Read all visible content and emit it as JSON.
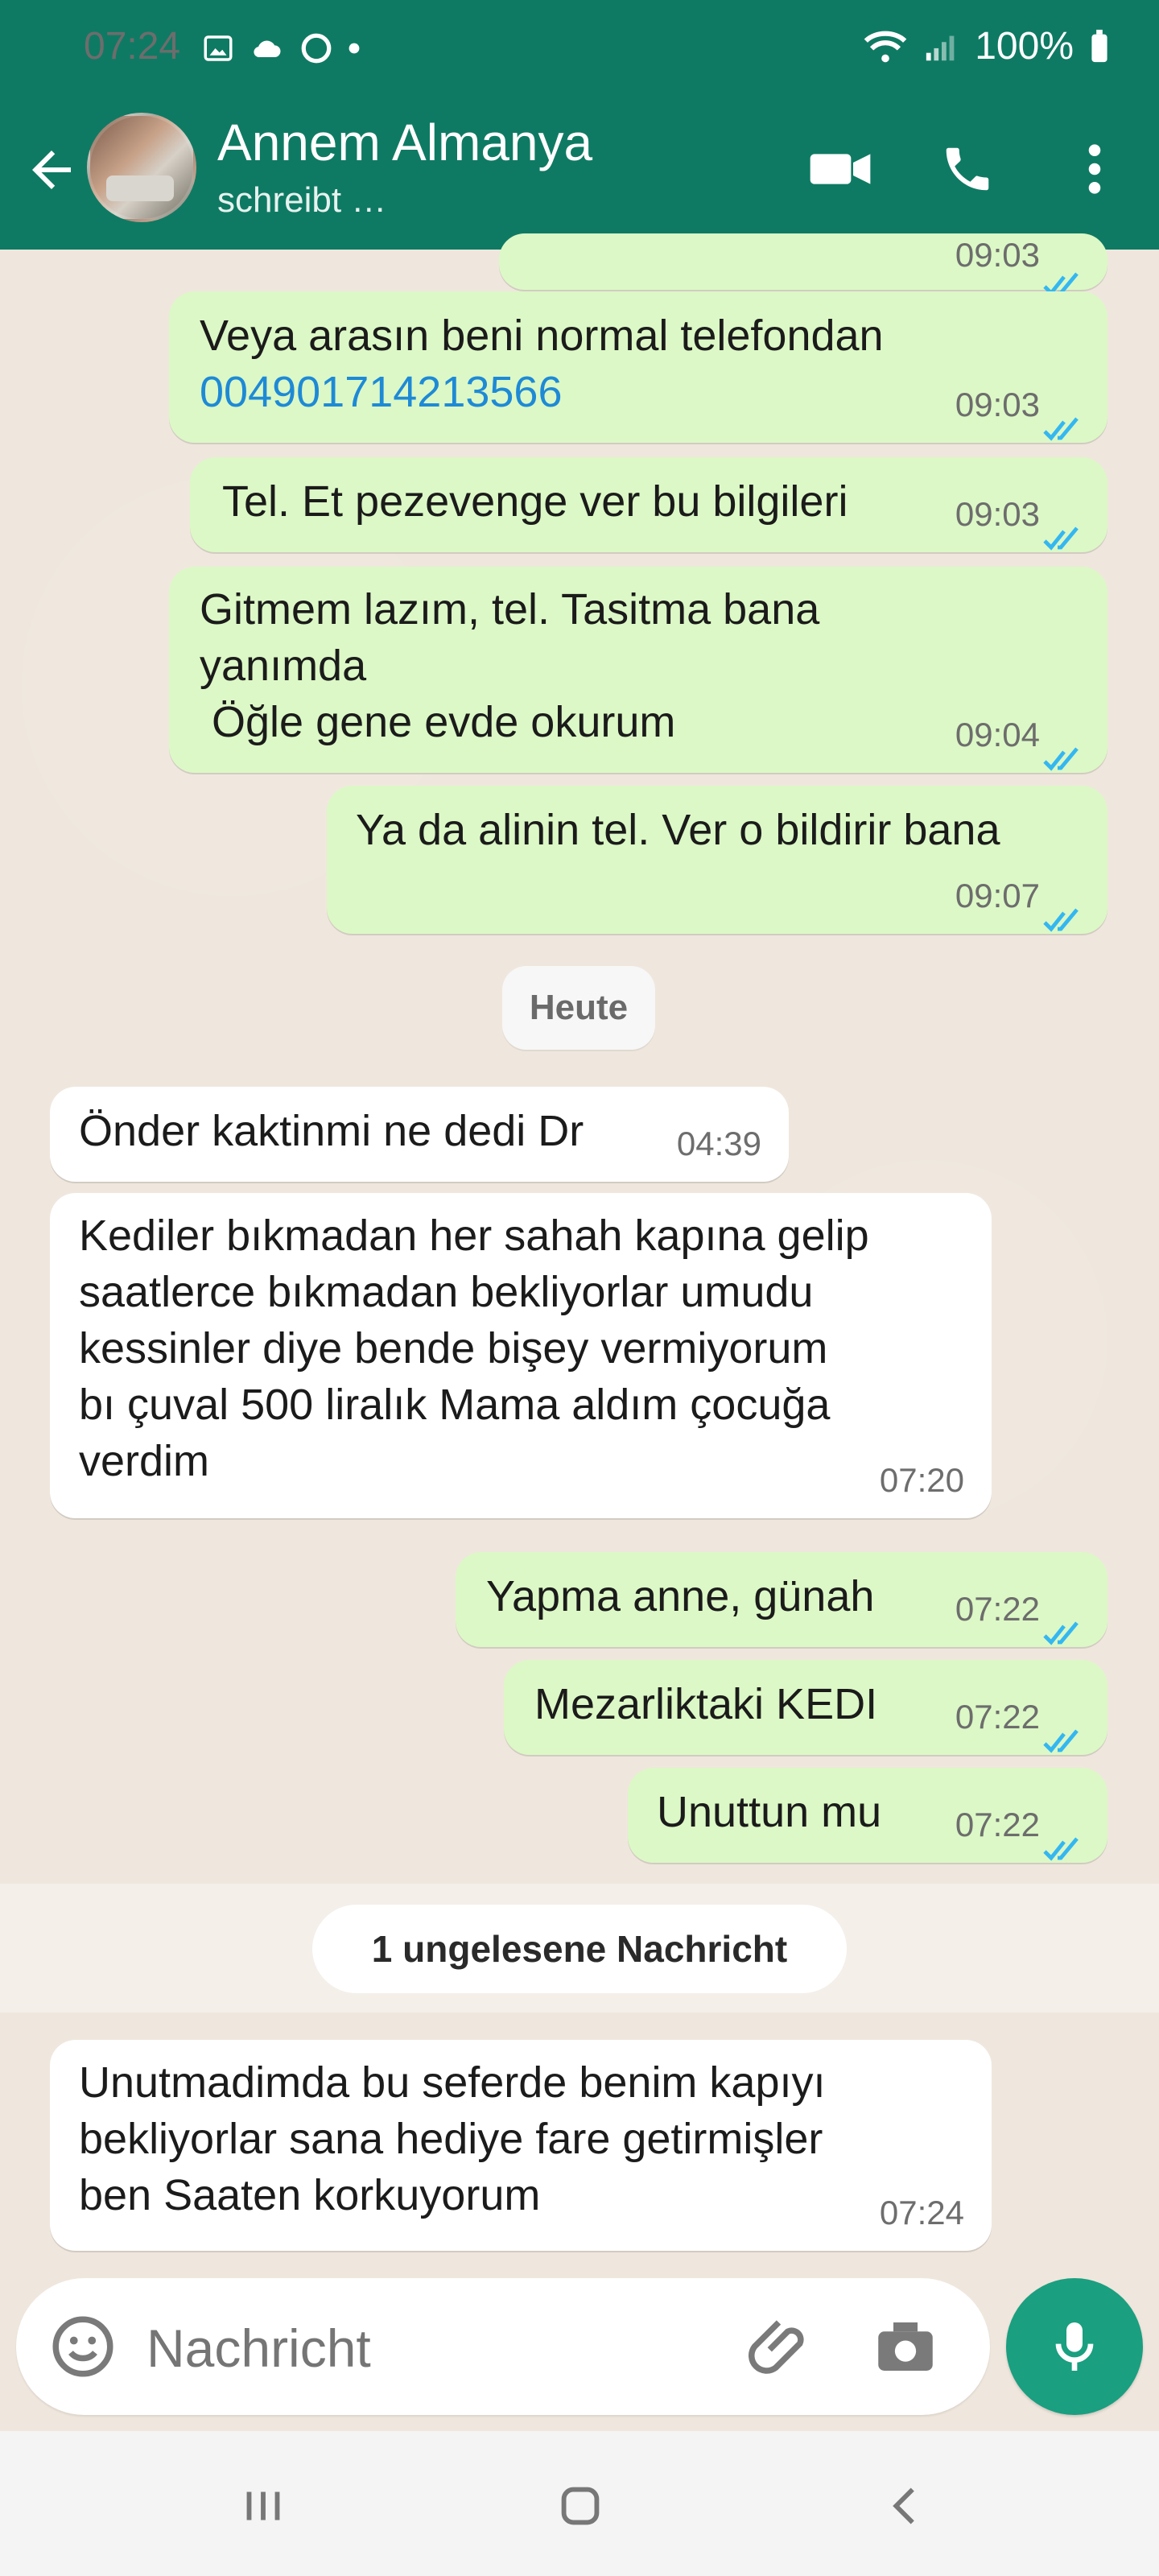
{
  "status": {
    "time": "07:24",
    "battery": "100%"
  },
  "header": {
    "title": "Annem Almanya",
    "subtitle": "schreibt …"
  },
  "messages": [
    {
      "dir": "out",
      "time": "09:03",
      "lines": [
        "Veya arasın beni normal telefondan"
      ],
      "link": "004901714213566"
    },
    {
      "dir": "out",
      "time": "09:03",
      "lines": [
        "Tel. Et pezevenge ver bu bilgileri"
      ]
    },
    {
      "dir": "out",
      "time": "09:04",
      "lines": [
        "Gitmem lazım, tel. Tasitma bana",
        "yanımda",
        " Öğle gene evde okurum"
      ]
    },
    {
      "dir": "out",
      "time": "09:07",
      "lines": [
        "Ya da alinin tel. Ver o bildirir bana"
      ]
    },
    {
      "dir": "in",
      "time": "04:39",
      "lines": [
        "Önder kaktinmi ne dedi Dr"
      ]
    },
    {
      "dir": "in",
      "time": "07:20",
      "lines": [
        "Kediler bıkmadan her sahah kapına gelip",
        "saatlerce bıkmadan bekliyorlar umudu",
        "kessinler diye bende bişey vermiyorum",
        "bı çuval 500 liralık Mama aldım çocuğa",
        "verdim"
      ]
    },
    {
      "dir": "out",
      "time": "07:22",
      "lines": [
        "Yapma anne, günah"
      ]
    },
    {
      "dir": "out",
      "time": "07:22",
      "lines": [
        "Mezarliktaki KEDI"
      ]
    },
    {
      "dir": "out",
      "time": "07:22",
      "lines": [
        "Unuttun mu"
      ]
    },
    {
      "dir": "in",
      "time": "07:24",
      "lines": [
        "Unutmadimda bu seferde benim kapıyı",
        "bekliyorlar sana hediye fare getirmişler",
        "ben Saaten korkuyorum"
      ]
    }
  ],
  "labels": {
    "day": "Heute",
    "unread": "1 ungelesene Nachricht"
  },
  "composer": {
    "placeholder": "Nachricht"
  },
  "colors": {
    "header": "#0f7a63",
    "outgoing": "#dcf8c6",
    "incoming": "#ffffff",
    "tick": "#34b7f1",
    "mic": "#1a9f80"
  }
}
